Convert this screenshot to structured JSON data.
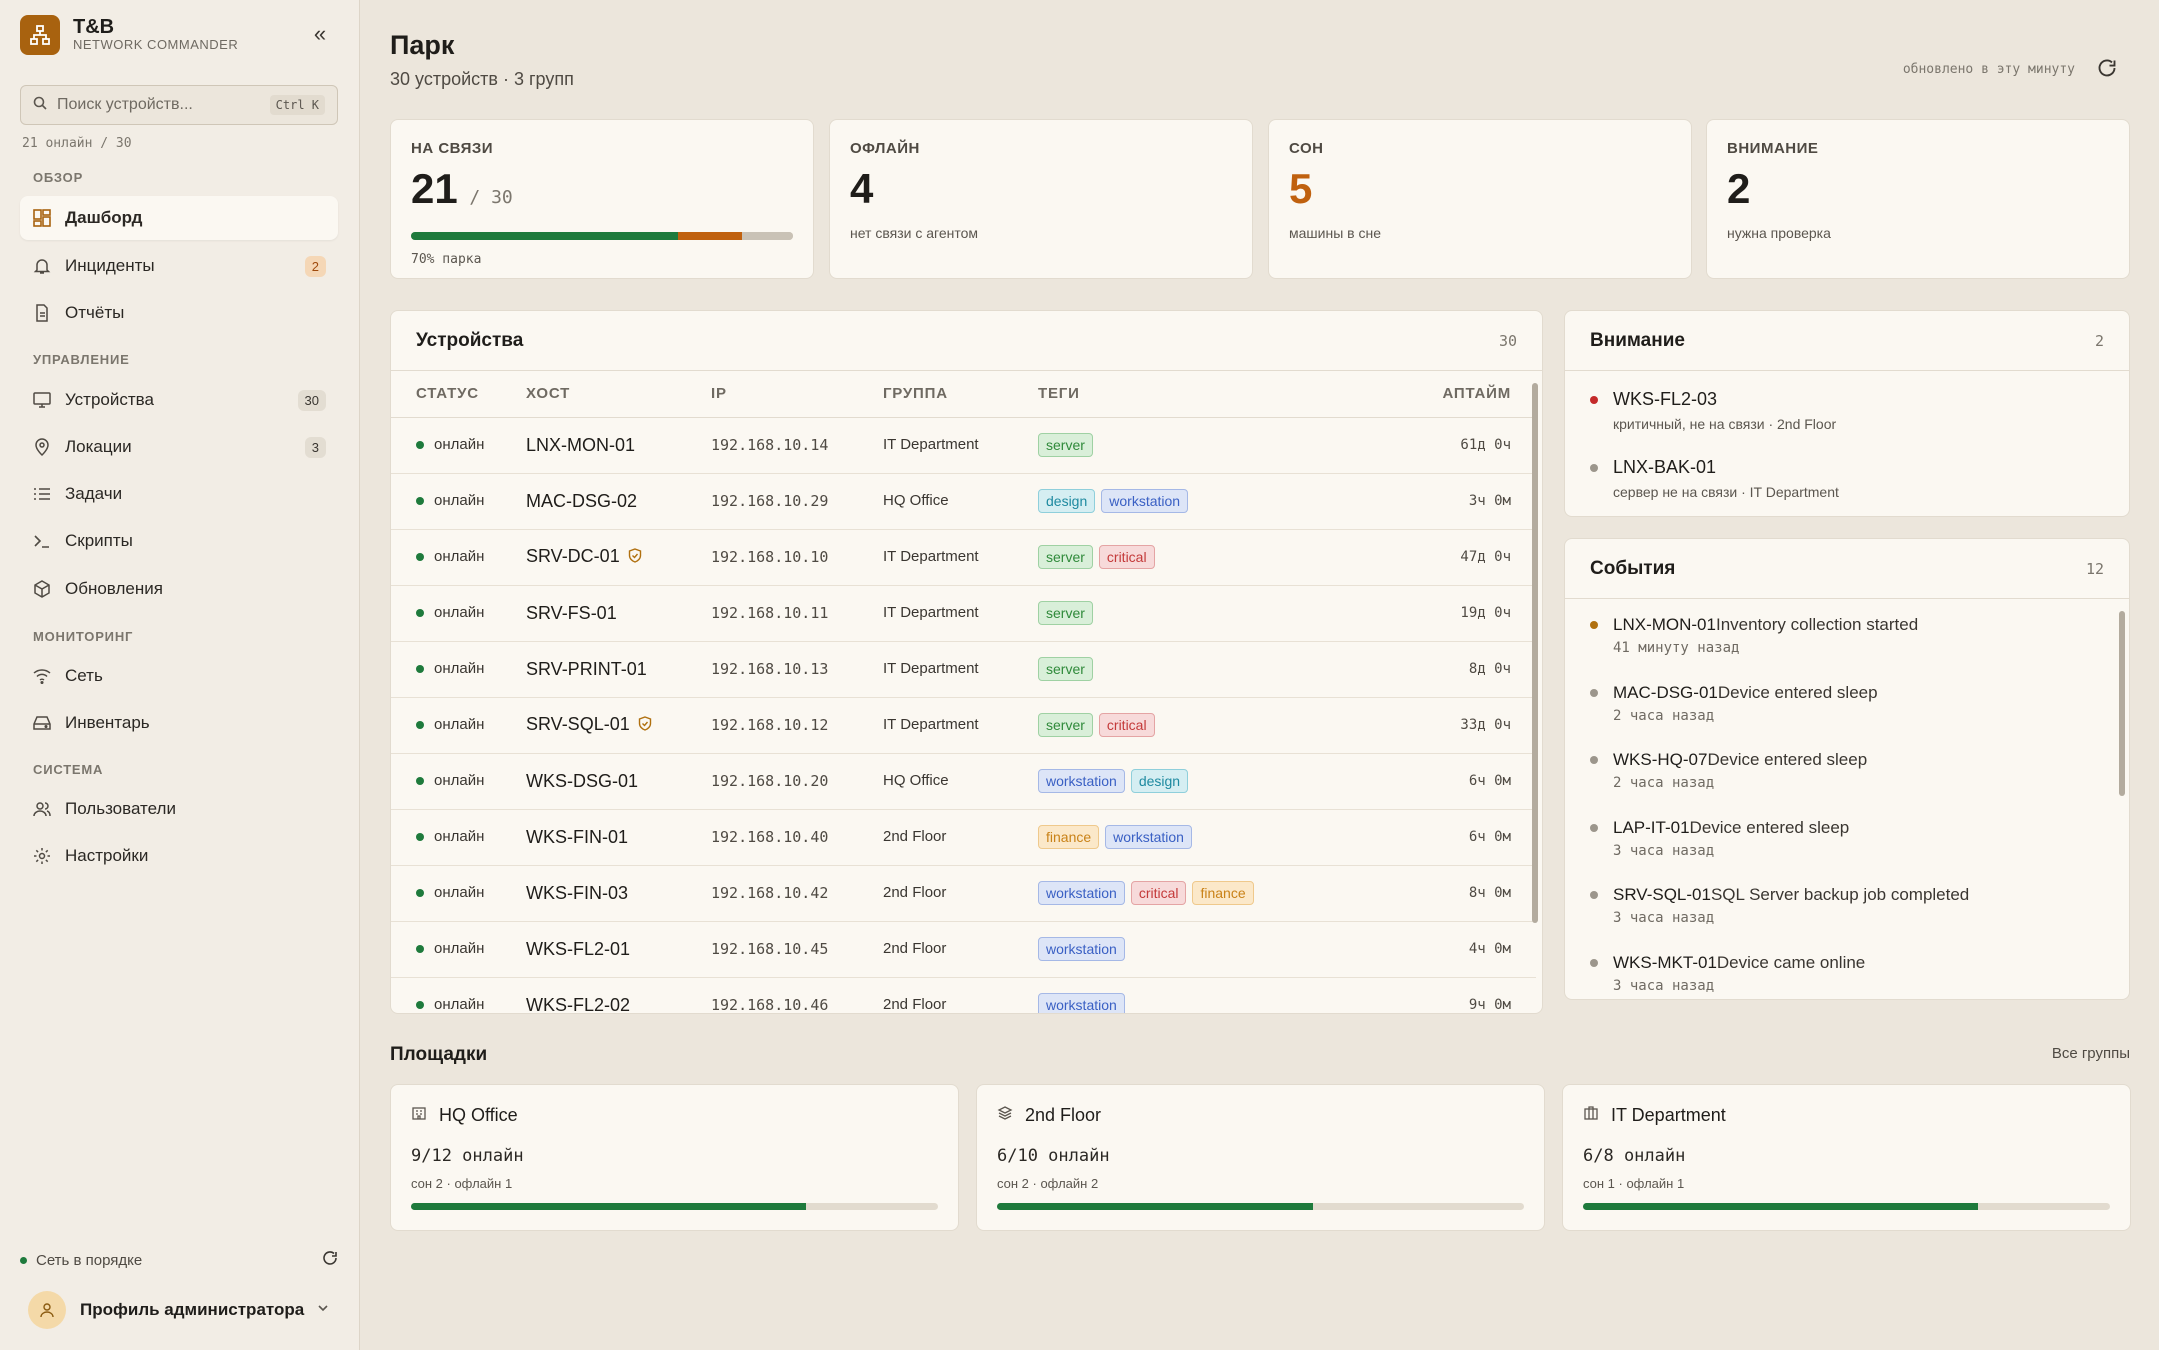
{
  "brand": {
    "name": "T&B",
    "subtitle": "NETWORK COMMANDER"
  },
  "search": {
    "placeholder": "Поиск устройств...",
    "shortcut": "Ctrl K"
  },
  "online_summary": "21 онлайн / 30",
  "sidebar": {
    "sections": [
      "ОБЗОР",
      "УПРАВЛЕНИЕ",
      "МОНИТОРИНГ",
      "СИСТЕМА"
    ],
    "items": [
      {
        "label": "Дашборд",
        "icon": "dashboard-icon",
        "active": true
      },
      {
        "label": "Инциденты",
        "icon": "bell-icon",
        "badge": "2"
      },
      {
        "label": "Отчёты",
        "icon": "document-icon"
      },
      {
        "label": "Устройства",
        "icon": "monitor-icon",
        "badge": "30"
      },
      {
        "label": "Локации",
        "icon": "map-pin-icon",
        "badge": "3"
      },
      {
        "label": "Задачи",
        "icon": "list-icon"
      },
      {
        "label": "Скрипты",
        "icon": "terminal-icon"
      },
      {
        "label": "Обновления",
        "icon": "package-icon"
      },
      {
        "label": "Сеть",
        "icon": "wifi-icon"
      },
      {
        "label": "Инвентарь",
        "icon": "drive-icon"
      },
      {
        "label": "Пользователи",
        "icon": "users-icon"
      },
      {
        "label": "Настройки",
        "icon": "gear-icon"
      }
    ],
    "status": "Сеть в порядке",
    "profile": "Профиль администратора"
  },
  "header": {
    "title": "Парк",
    "subtitle": "30 устройств · 3 групп",
    "updated": "обновлено в эту минуту"
  },
  "stats": [
    {
      "label": "НА СВЯЗИ",
      "value": "21",
      "of": "/ 30",
      "note": "70% парка",
      "segments": {
        "online": 0.7,
        "sleep": 0.167,
        "offline": 0.133
      }
    },
    {
      "label": "ОФЛАЙН",
      "value": "4",
      "note": "нет связи с агентом"
    },
    {
      "label": "СОН",
      "value": "5",
      "note": "машины в сне"
    },
    {
      "label": "ВНИМАНИЕ",
      "value": "2",
      "note": "нужна проверка"
    }
  ],
  "devices": {
    "title": "Устройства",
    "count": "30",
    "columns": [
      "СТАТУС",
      "ХОСТ",
      "IP",
      "ГРУППА",
      "ТЕГИ",
      "АПТАЙМ"
    ],
    "rows": [
      {
        "status": "онлайн",
        "host": "LNX-MON-01",
        "ip": "192.168.10.14",
        "group": "IT Department",
        "tags": [
          "server"
        ],
        "uptime": "61д 0ч"
      },
      {
        "status": "онлайн",
        "host": "MAC-DSG-02",
        "ip": "192.168.10.29",
        "group": "HQ Office",
        "tags": [
          "design",
          "workstation"
        ],
        "uptime": "3ч 0м"
      },
      {
        "status": "онлайн",
        "host": "SRV-DC-01",
        "shield": true,
        "ip": "192.168.10.10",
        "group": "IT Department",
        "tags": [
          "server",
          "critical"
        ],
        "uptime": "47д 0ч"
      },
      {
        "status": "онлайн",
        "host": "SRV-FS-01",
        "ip": "192.168.10.11",
        "group": "IT Department",
        "tags": [
          "server"
        ],
        "uptime": "19д 0ч"
      },
      {
        "status": "онлайн",
        "host": "SRV-PRINT-01",
        "ip": "192.168.10.13",
        "group": "IT Department",
        "tags": [
          "server"
        ],
        "uptime": "8д 0ч"
      },
      {
        "status": "онлайн",
        "host": "SRV-SQL-01",
        "shield": true,
        "ip": "192.168.10.12",
        "group": "IT Department",
        "tags": [
          "server",
          "critical"
        ],
        "uptime": "33д 0ч"
      },
      {
        "status": "онлайн",
        "host": "WKS-DSG-01",
        "ip": "192.168.10.20",
        "group": "HQ Office",
        "tags": [
          "workstation",
          "design"
        ],
        "uptime": "6ч 0м"
      },
      {
        "status": "онлайн",
        "host": "WKS-FIN-01",
        "ip": "192.168.10.40",
        "group": "2nd Floor",
        "tags": [
          "finance",
          "workstation"
        ],
        "uptime": "6ч 0м"
      },
      {
        "status": "онлайн",
        "host": "WKS-FIN-03",
        "ip": "192.168.10.42",
        "group": "2nd Floor",
        "tags": [
          "workstation",
          "critical",
          "finance"
        ],
        "uptime": "8ч 0м"
      },
      {
        "status": "онлайн",
        "host": "WKS-FL2-01",
        "ip": "192.168.10.45",
        "group": "2nd Floor",
        "tags": [
          "workstation"
        ],
        "uptime": "4ч 0м"
      },
      {
        "status": "онлайн",
        "host": "WKS-FL2-02",
        "ip": "192.168.10.46",
        "group": "2nd Floor",
        "tags": [
          "workstation"
        ],
        "uptime": "9ч 0м"
      }
    ]
  },
  "attention": {
    "title": "Внимание",
    "count": "2",
    "items": [
      {
        "name": "WKS-FL2-03",
        "desc": "критичный, не на связи · 2nd Floor",
        "color": "#c42a2a"
      },
      {
        "name": "LNX-BAK-01",
        "desc": "сервер не на связи · IT Department",
        "color": "#9c968c"
      }
    ]
  },
  "events": {
    "title": "События",
    "count": "12",
    "items": [
      {
        "host": "LNX-MON-01",
        "msg": "Inventory collection started",
        "time": "41 минуту назад",
        "color": "#b0700f"
      },
      {
        "host": "MAC-DSG-01",
        "msg": "Device entered sleep",
        "time": "2 часа назад",
        "color": "#9c968c"
      },
      {
        "host": "WKS-HQ-07",
        "msg": "Device entered sleep",
        "time": "2 часа назад",
        "color": "#9c968c"
      },
      {
        "host": "LAP-IT-01",
        "msg": "Device entered sleep",
        "time": "3 часа назад",
        "color": "#9c968c"
      },
      {
        "host": "SRV-SQL-01",
        "msg": "SQL Server backup job completed",
        "time": "3 часа назад",
        "color": "#9c968c"
      },
      {
        "host": "WKS-MKT-01",
        "msg": "Device came online",
        "time": "3 часа назад",
        "color": "#9c968c"
      }
    ]
  },
  "sites": {
    "title": "Площадки",
    "all": "Все группы",
    "items": [
      {
        "name": "HQ Office",
        "icon": "building-icon",
        "count": "9/12 онлайн",
        "sub": "сон 2 · офлайн 1",
        "fill": 0.75
      },
      {
        "name": "2nd Floor",
        "icon": "layers-icon",
        "count": "6/10 онлайн",
        "sub": "сон 2 · офлайн 2",
        "fill": 0.6
      },
      {
        "name": "IT Department",
        "icon": "office-icon",
        "count": "6/8 онлайн",
        "sub": "сон 1 · офлайн 1",
        "fill": 0.75
      }
    ]
  },
  "colors": {
    "accent": "#a8620f",
    "online": "#1e7a3c",
    "sleep": "#c0610f",
    "offline": "#c9c2b6",
    "critical": "#c42a2a"
  }
}
